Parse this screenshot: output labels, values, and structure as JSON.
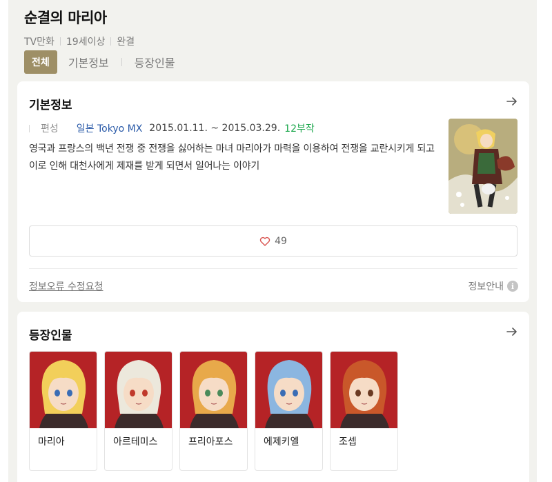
{
  "header": {
    "title": "순결의 마리아",
    "meta": [
      "TV만화",
      "19세이상",
      "완결"
    ]
  },
  "tabs": [
    {
      "label": "전체",
      "active": true
    },
    {
      "label": "기본정보",
      "active": false
    },
    {
      "label": "등장인물",
      "active": false
    }
  ],
  "basic_info": {
    "title": "기본정보",
    "broadcast_label": "편성",
    "channel": "일본 Tokyo MX",
    "dates": "2015.01.11. ~ 2015.03.29.",
    "episodes": "12부작",
    "synopsis": "영국과 프랑스의 백년 전쟁 중 전쟁을 싫어하는 마녀 마리아가 마력을 이용하여 전쟁을 교란시키게 되고 이로 인해 대천사에게 제재를 받게 되면서 일어나는 이야기",
    "likes": "49",
    "report_link": "정보오류 수정요청",
    "info_guide": "정보안내"
  },
  "characters": {
    "title": "등장인물",
    "items": [
      {
        "name": "마리아",
        "hair": "#f2cf5a",
        "eyes": "#3a6db5"
      },
      {
        "name": "아르테미스",
        "hair": "#ece8dc",
        "eyes": "#c0392b"
      },
      {
        "name": "프리아포스",
        "hair": "#e8a94a",
        "eyes": "#4a8a5a"
      },
      {
        "name": "에제키엘",
        "hair": "#8bb6e0",
        "eyes": "#3a6db5"
      },
      {
        "name": "조셉",
        "hair": "#c9582a",
        "eyes": "#6b3a22"
      }
    ]
  },
  "colors": {
    "tab_active_bg": "#9e8f66",
    "channel_link": "#2a5aa8",
    "episodes": "#1aa64b",
    "character_bg": "#b52326"
  },
  "icons": [
    "arrow-right-icon",
    "heart-icon",
    "info-icon"
  ]
}
